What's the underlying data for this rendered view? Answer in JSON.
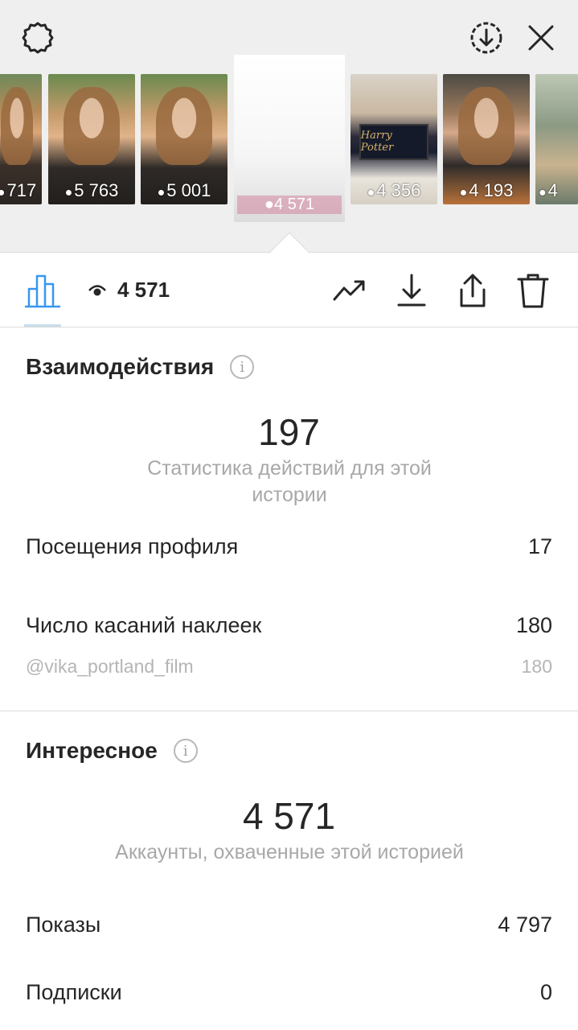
{
  "story_strip": {
    "thumbnails": [
      {
        "views": "717"
      },
      {
        "views": "5 763"
      },
      {
        "views": "5 001"
      },
      {
        "views": "4 356"
      },
      {
        "views": "4 193"
      },
      {
        "views": "4"
      }
    ],
    "selected": {
      "label": "4 571"
    },
    "poster_text": "Harry Potter"
  },
  "toolbar": {
    "views_count": "4 571"
  },
  "interactions": {
    "title": "Взаимодействия",
    "total": "197",
    "caption": "Статистика действий для этой истории",
    "rows": [
      {
        "label": "Посещения профиля",
        "value": "17"
      },
      {
        "label": "Число касаний наклеек",
        "value": "180"
      }
    ],
    "sub_row": {
      "label": "@vika_portland_film",
      "value": "180"
    }
  },
  "discovery": {
    "title": "Интересное",
    "total": "4 571",
    "caption": "Аккаунты, охваченные этой историей",
    "rows": [
      {
        "label": "Показы",
        "value": "4 797"
      },
      {
        "label": "Подписки",
        "value": "0"
      }
    ]
  },
  "colors": {
    "accent": "#3897f0",
    "text": "#262626",
    "muted": "#a8a8a8",
    "divider": "#dbdbdb"
  }
}
